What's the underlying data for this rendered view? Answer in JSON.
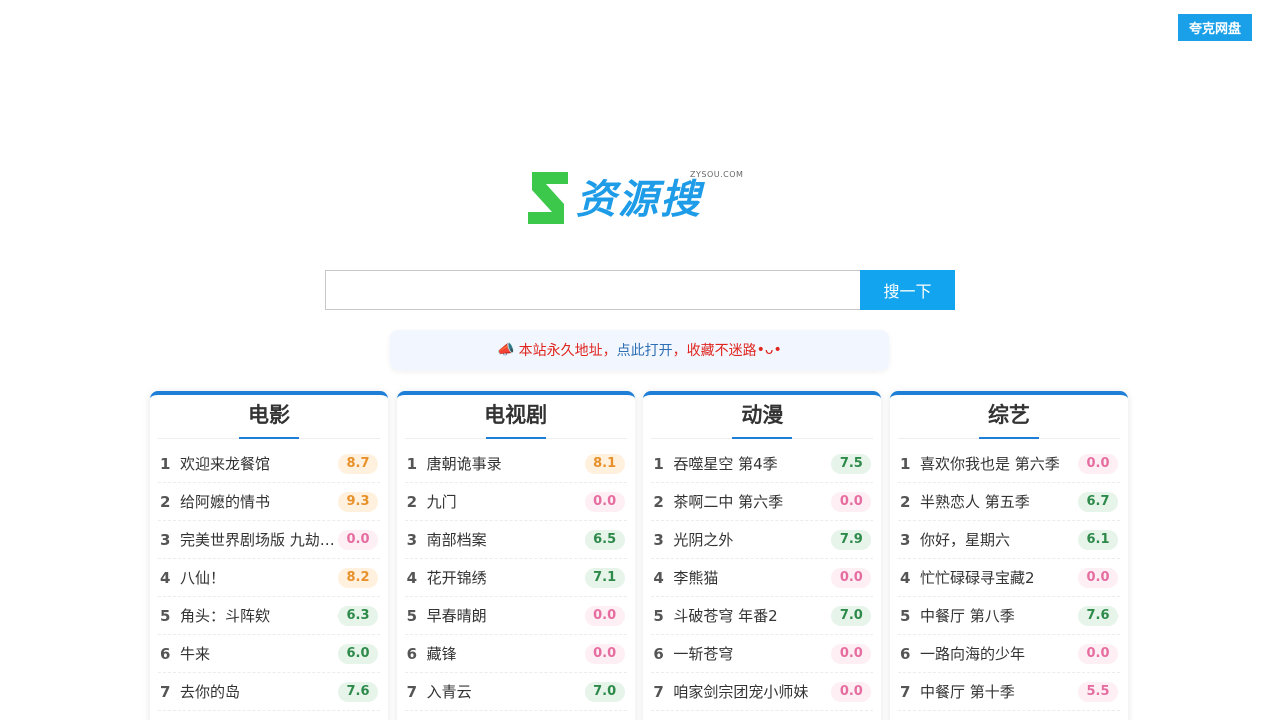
{
  "top_button": "夸克网盘",
  "logo": {
    "text": "资源搜",
    "domain": "ZYSOU.COM"
  },
  "search": {
    "value": "",
    "placeholder": "",
    "button": "搜一下"
  },
  "notice": {
    "icon": "📣",
    "part1": "本站永久地址，",
    "link": "点此打开",
    "part2": "，收藏不迷路",
    "emoji": "•ᴗ•"
  },
  "colors": {
    "accent": "#12a4ee",
    "card_border": "#1f7fd6",
    "brand_green": "#3cc84b"
  },
  "cards": [
    {
      "title": "电影",
      "items": [
        {
          "rank": "1",
          "name": "欢迎来龙餐馆",
          "score": "8.7",
          "tone": "orange"
        },
        {
          "rank": "2",
          "name": "给阿嬷的情书",
          "score": "9.3",
          "tone": "orange"
        },
        {
          "rank": "3",
          "name": "完美世界剧场版 九劫…",
          "score": "0.0",
          "tone": "pink"
        },
        {
          "rank": "4",
          "name": "八仙！",
          "score": "8.2",
          "tone": "orange"
        },
        {
          "rank": "5",
          "name": "角头：斗阵欸",
          "score": "6.3",
          "tone": "green"
        },
        {
          "rank": "6",
          "name": "牛来",
          "score": "6.0",
          "tone": "green"
        },
        {
          "rank": "7",
          "name": "去你的岛",
          "score": "7.6",
          "tone": "green"
        }
      ]
    },
    {
      "title": "电视剧",
      "items": [
        {
          "rank": "1",
          "name": "唐朝诡事录",
          "score": "8.1",
          "tone": "orange"
        },
        {
          "rank": "2",
          "name": "九门",
          "score": "0.0",
          "tone": "pink"
        },
        {
          "rank": "3",
          "name": "南部档案",
          "score": "6.5",
          "tone": "green"
        },
        {
          "rank": "4",
          "name": "花开锦绣",
          "score": "7.1",
          "tone": "green"
        },
        {
          "rank": "5",
          "name": "早春晴朗",
          "score": "0.0",
          "tone": "pink"
        },
        {
          "rank": "6",
          "name": "藏锋",
          "score": "0.0",
          "tone": "pink"
        },
        {
          "rank": "7",
          "name": "入青云",
          "score": "7.0",
          "tone": "green"
        }
      ]
    },
    {
      "title": "动漫",
      "items": [
        {
          "rank": "1",
          "name": "吞噬星空 第4季",
          "score": "7.5",
          "tone": "green"
        },
        {
          "rank": "2",
          "name": "茶啊二中 第六季",
          "score": "0.0",
          "tone": "pink"
        },
        {
          "rank": "3",
          "name": "光阴之外",
          "score": "7.9",
          "tone": "green"
        },
        {
          "rank": "4",
          "name": "李熊猫",
          "score": "0.0",
          "tone": "pink"
        },
        {
          "rank": "5",
          "name": "斗破苍穹 年番2",
          "score": "7.0",
          "tone": "green"
        },
        {
          "rank": "6",
          "name": "一斩苍穹",
          "score": "0.0",
          "tone": "pink"
        },
        {
          "rank": "7",
          "name": "咱家剑宗团宠小师妹",
          "score": "0.0",
          "tone": "pink"
        }
      ]
    },
    {
      "title": "综艺",
      "items": [
        {
          "rank": "1",
          "name": "喜欢你我也是 第六季",
          "score": "0.0",
          "tone": "pink"
        },
        {
          "rank": "2",
          "name": "半熟恋人 第五季",
          "score": "6.7",
          "tone": "green"
        },
        {
          "rank": "3",
          "name": "你好，星期六",
          "score": "6.1",
          "tone": "green"
        },
        {
          "rank": "4",
          "name": "忙忙碌碌寻宝藏2",
          "score": "0.0",
          "tone": "pink"
        },
        {
          "rank": "5",
          "name": "中餐厅 第八季",
          "score": "7.6",
          "tone": "green"
        },
        {
          "rank": "6",
          "name": "一路向海的少年",
          "score": "0.0",
          "tone": "pink"
        },
        {
          "rank": "7",
          "name": "中餐厅 第十季",
          "score": "5.5",
          "tone": "pink"
        }
      ]
    }
  ]
}
